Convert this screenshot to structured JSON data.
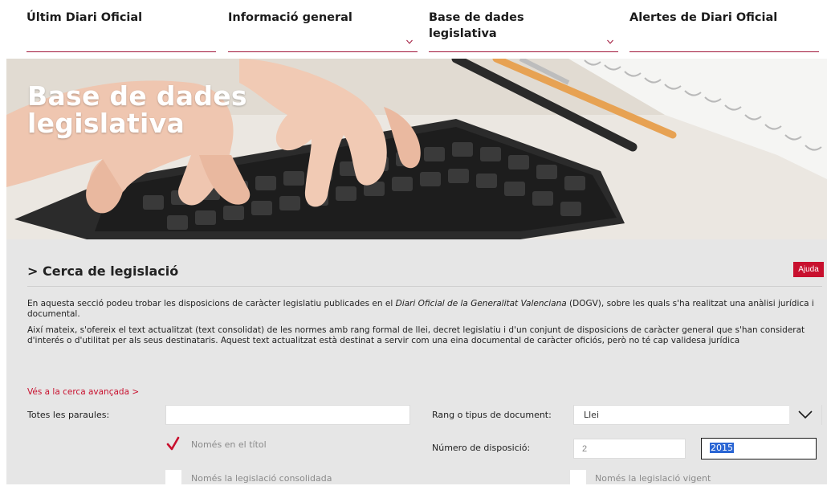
{
  "nav": {
    "items": [
      {
        "label": "Últim Diari Oficial",
        "has_dropdown": false
      },
      {
        "label": "Informació general",
        "has_dropdown": true
      },
      {
        "label": "Base de dades legislativa",
        "has_dropdown": true
      },
      {
        "label": "Alertes de Diari Oficial",
        "has_dropdown": false
      }
    ]
  },
  "hero": {
    "title": "Base de dades legislativa"
  },
  "search": {
    "title": "> Cerca de legislació",
    "help_button": "Ajuda",
    "intro": {
      "p1_before": "En aquesta secció podeu trobar les disposicions de caràcter legislatiu publicades en el ",
      "p1_italic": "Diari Oficial de la Generalitat Valenciana",
      "p1_after": " (DOGV), sobre les quals s'ha realitzat una anàlisi jurídica i documental.",
      "p2": "Així mateix, s'ofereix el text actualitzat (text consolidat) de les normes amb rang formal de llei, decret legislatiu i d'un conjunt de disposicions de caràcter general que s'han considerat d'interés o d'utilitat per als seus destinataris. Aquest text actualitzat està destinat a servir com una eina documental de caràcter oficiós, però no té cap validesa jurídica"
    },
    "advanced_link": "Vés a la cerca avançada >",
    "fields": {
      "all_words_label": "Totes les paraules:",
      "all_words_value": "",
      "title_only_label": "Només en el títol",
      "title_only_checked": true,
      "consolidated_label": "Només la legislació consolidada",
      "consolidated_checked": false,
      "doc_type_label": "Rang o tipus de document:",
      "doc_type_value": "Llei",
      "disposition_number_label": "Número de disposició:",
      "disposition_number_value": "2",
      "year_value": "2015",
      "in_force_label": "Només la legislació vigent",
      "in_force_checked": false
    }
  },
  "colors": {
    "accent": "#c8102e",
    "nav_underline": "#a0163a",
    "panel_bg": "#e6e6e6",
    "selection": "#2b66d4"
  }
}
